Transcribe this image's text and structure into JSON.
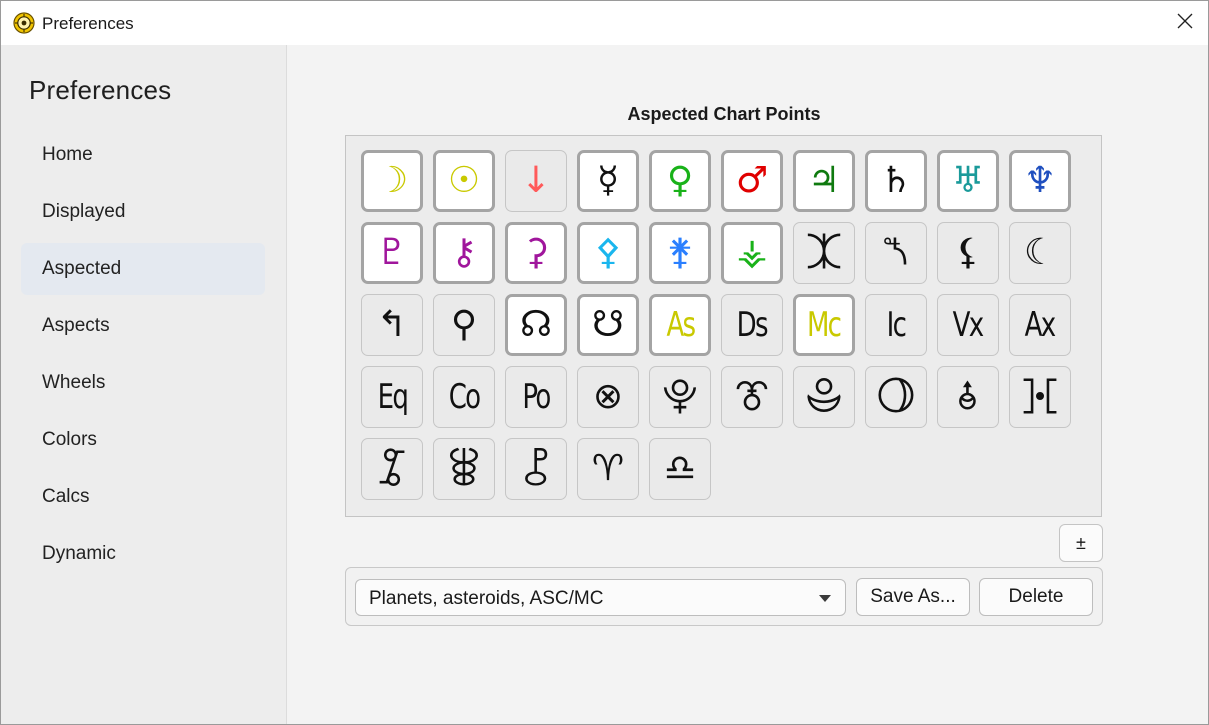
{
  "window": {
    "title": "Preferences",
    "icon": "sun-gear-icon"
  },
  "sidebar": {
    "heading": "Preferences",
    "items": [
      {
        "label": "Home",
        "active": false
      },
      {
        "label": "Displayed",
        "active": false
      },
      {
        "label": "Aspected",
        "active": true
      },
      {
        "label": "Aspects",
        "active": false
      },
      {
        "label": "Wheels",
        "active": false
      },
      {
        "label": "Colors",
        "active": false
      },
      {
        "label": "Calcs",
        "active": false
      },
      {
        "label": "Dynamic",
        "active": false
      }
    ]
  },
  "main": {
    "section_title": "Aspected Chart Points",
    "points": [
      {
        "name": "moon",
        "glyph": "☽",
        "color": "#c9c900",
        "selected": true,
        "kind": "sym"
      },
      {
        "name": "sun",
        "glyph": "☉",
        "color": "#c9c900",
        "selected": true,
        "kind": "sym"
      },
      {
        "name": "earth",
        "glyph": "↓",
        "color": "#ff5a5a",
        "selected": false,
        "kind": "sym"
      },
      {
        "name": "mercury",
        "glyph": "☿",
        "color": "#111111",
        "selected": true,
        "kind": "sym"
      },
      {
        "name": "venus",
        "glyph": "♀",
        "color": "#19b219",
        "selected": true,
        "kind": "sym"
      },
      {
        "name": "mars",
        "glyph": "♂",
        "color": "#e00000",
        "selected": true,
        "kind": "sym"
      },
      {
        "name": "jupiter",
        "glyph": "♃",
        "color": "#0f7a0f",
        "selected": true,
        "kind": "sym"
      },
      {
        "name": "saturn",
        "glyph": "♄",
        "color": "#111111",
        "selected": true,
        "kind": "sym"
      },
      {
        "name": "uranus",
        "glyph": "♅",
        "color": "#1a9a9a",
        "selected": true,
        "kind": "sym"
      },
      {
        "name": "neptune",
        "glyph": "♆",
        "color": "#1f4fbf",
        "selected": true,
        "kind": "sym"
      },
      {
        "name": "pluto",
        "glyph": "♇",
        "color": "#a0169c",
        "selected": true,
        "kind": "sym"
      },
      {
        "name": "chiron",
        "glyph": "⚷",
        "color": "#a0169c",
        "selected": true,
        "kind": "sym"
      },
      {
        "name": "ceres",
        "glyph": "⚳",
        "color": "#a0169c",
        "selected": true,
        "kind": "sym"
      },
      {
        "name": "pallas",
        "glyph": "⚴",
        "color": "#1ab6ee",
        "selected": true,
        "kind": "sym"
      },
      {
        "name": "juno",
        "glyph": "⚵",
        "color": "#2a7fff",
        "selected": true,
        "kind": "sym"
      },
      {
        "name": "vesta",
        "glyph": "⚶",
        "color": "#19b219",
        "selected": true,
        "kind": "sym"
      },
      {
        "name": "eris",
        "glyph": "⯰",
        "color": "#111111",
        "selected": false,
        "kind": "sym"
      },
      {
        "name": "sedna",
        "glyph": "⯲",
        "color": "#111111",
        "selected": false,
        "kind": "sym"
      },
      {
        "name": "black-moon-lilith",
        "glyph": "⚸",
        "color": "#111111",
        "selected": false,
        "kind": "sym"
      },
      {
        "name": "white-moon",
        "glyph": "☾",
        "color": "#111111",
        "selected": false,
        "kind": "sym"
      },
      {
        "name": "point-21",
        "glyph": "↰",
        "color": "#111111",
        "selected": false,
        "kind": "sym"
      },
      {
        "name": "point-22",
        "glyph": "⚲",
        "color": "#111111",
        "selected": false,
        "kind": "sym"
      },
      {
        "name": "north-node",
        "glyph": "☊",
        "color": "#111111",
        "selected": true,
        "kind": "sym"
      },
      {
        "name": "south-node",
        "glyph": "☋",
        "color": "#111111",
        "selected": true,
        "kind": "sym"
      },
      {
        "name": "ascendant",
        "glyph": "As",
        "color": "#c9c900",
        "selected": true,
        "kind": "txt"
      },
      {
        "name": "descendant",
        "glyph": "Ds",
        "color": "#111111",
        "selected": false,
        "kind": "txt"
      },
      {
        "name": "midheaven",
        "glyph": "Mc",
        "color": "#c9c900",
        "selected": true,
        "kind": "txt"
      },
      {
        "name": "imum-coeli",
        "glyph": "Ic",
        "color": "#111111",
        "selected": false,
        "kind": "txt"
      },
      {
        "name": "vertex",
        "glyph": "Vx",
        "color": "#111111",
        "selected": false,
        "kind": "txt"
      },
      {
        "name": "anti-vertex",
        "glyph": "Ax",
        "color": "#111111",
        "selected": false,
        "kind": "txt"
      },
      {
        "name": "equatorial-ascendant",
        "glyph": "Eq",
        "color": "#111111",
        "selected": false,
        "kind": "txt"
      },
      {
        "name": "co-ascendant",
        "glyph": "Co",
        "color": "#111111",
        "selected": false,
        "kind": "txt"
      },
      {
        "name": "polar-ascendant",
        "glyph": "Po",
        "color": "#111111",
        "selected": false,
        "kind": "txt"
      },
      {
        "name": "part-of-fortune",
        "glyph": "⊗",
        "color": "#111111",
        "selected": false,
        "kind": "sym"
      },
      {
        "name": "point-35",
        "glyph": "⯓",
        "color": "#111111",
        "selected": false,
        "kind": "sym"
      },
      {
        "name": "point-36",
        "glyph": "⯔",
        "color": "#111111",
        "selected": false,
        "kind": "sym"
      },
      {
        "name": "point-37",
        "glyph": "⯕",
        "color": "#111111",
        "selected": false,
        "kind": "sym"
      },
      {
        "name": "point-38",
        "glyph": "⯖",
        "color": "#111111",
        "selected": false,
        "kind": "sym"
      },
      {
        "name": "point-39",
        "glyph": "⯗",
        "color": "#111111",
        "selected": false,
        "kind": "sym"
      },
      {
        "name": "point-40",
        "glyph": "⯘",
        "color": "#111111",
        "selected": false,
        "kind": "sym"
      },
      {
        "name": "point-41",
        "glyph": "⯙",
        "color": "#111111",
        "selected": false,
        "kind": "sym"
      },
      {
        "name": "point-42",
        "glyph": "⯚",
        "color": "#111111",
        "selected": false,
        "kind": "sym"
      },
      {
        "name": "point-43",
        "glyph": "⯛",
        "color": "#111111",
        "selected": false,
        "kind": "sym"
      },
      {
        "name": "aries-point",
        "glyph": "♈",
        "color": "#111111",
        "selected": false,
        "kind": "sym"
      },
      {
        "name": "libra-point",
        "glyph": "♎",
        "color": "#111111",
        "selected": false,
        "kind": "sym"
      }
    ],
    "plusminus_label": "±",
    "preset": {
      "selected": "Planets, asteroids, ASC/MC",
      "save_label": "Save As...",
      "delete_label": "Delete"
    }
  }
}
